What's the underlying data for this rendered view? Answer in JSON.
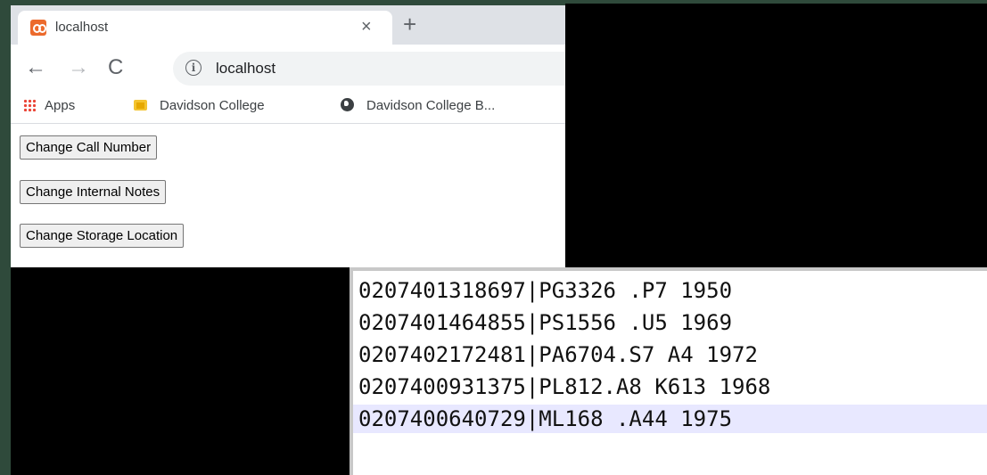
{
  "browser": {
    "tab": {
      "title": "localhost",
      "close": "×"
    },
    "new_tab": "+",
    "nav": {
      "back": "←",
      "forward": "→",
      "reload": "C"
    },
    "omnibox": {
      "info": "i",
      "url": "localhost"
    },
    "bookmarks": [
      {
        "label": "Apps",
        "icon": "apps-grid-icon"
      },
      {
        "label": "Davidson College",
        "icon": "folder-icon"
      },
      {
        "label": "Davidson College B...",
        "icon": "globe-icon"
      }
    ]
  },
  "page": {
    "buttons": [
      "Change Call Number",
      "Change Internal Notes",
      "Change Storage Location"
    ]
  },
  "editor": {
    "lines": [
      "0207401318697|PG3326 .P7 1950",
      "0207401464855|PS1556 .U5 1969",
      "0207402172481|PA6704.S7 A4 1972",
      "0207400931375|PL812.A8 K613 1968",
      "0207400640729|ML168 .A44 1975"
    ],
    "highlighted_line": 5
  },
  "colors": {
    "backdrop": "#2f4a3b",
    "tab_favicon": "#ec6a2c",
    "line_highlight": "#e8e8ff"
  }
}
